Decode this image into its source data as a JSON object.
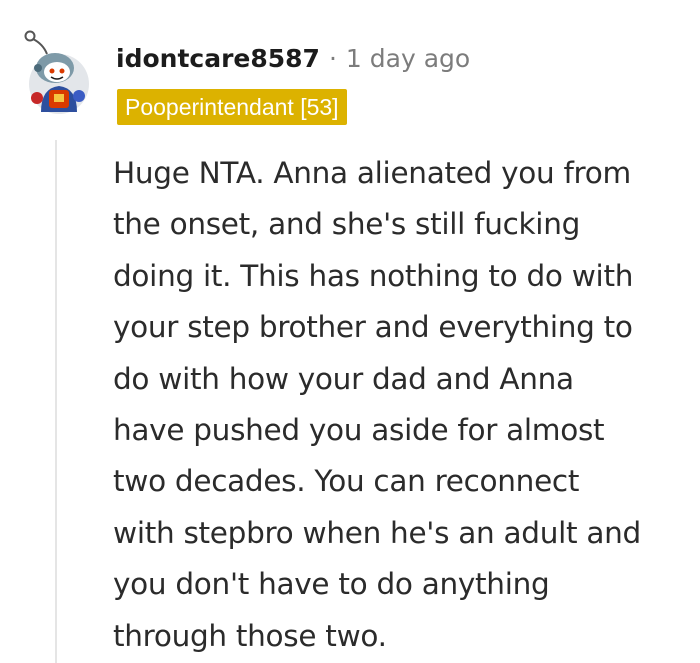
{
  "comment": {
    "username": "idontcare8587",
    "separator": "·",
    "timestamp": "1 day ago",
    "flair": "Pooperintendant [53]",
    "avatar": "snoo-avatar-icon",
    "body_lines": [
      "Huge NTA. Anna alienated you from",
      "the onset, and she's still fucking",
      "doing it. This has nothing to do with",
      "your step brother and everything to",
      "do with how your dad and Anna",
      "have pushed you aside for almost",
      "two decades. You can reconnect",
      "with stepbro when he's an adult and",
      "you don't have to do anything",
      "through those two."
    ]
  },
  "colors": {
    "flair_bg": "#dcb200",
    "flair_text": "#ffffff",
    "meta_text": "#7c7c7c",
    "thread_line": "#e5e5e5"
  }
}
